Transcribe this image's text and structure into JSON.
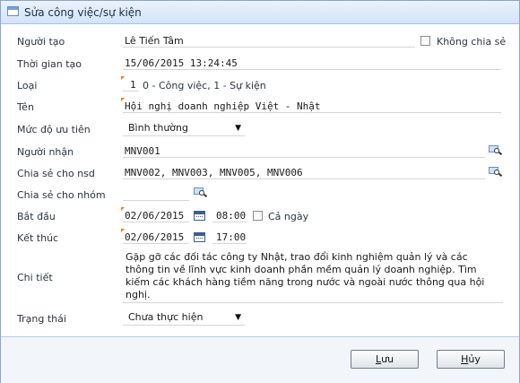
{
  "dialog": {
    "title": "Sửa công việc/sự kiện"
  },
  "form": {
    "creator": {
      "label": "Người tạo",
      "value": "Lê Tiến Tâm"
    },
    "no_share": {
      "label": "Không chia sẻ",
      "checked": false
    },
    "created_time": {
      "label": "Thời gian tạo",
      "value": "15/06/2015 13:24:45"
    },
    "type": {
      "label": "Loại",
      "value": "1",
      "hint": "0 - Công việc, 1 - Sự kiện"
    },
    "name": {
      "label": "Tên",
      "value": "Hội nghị doanh nghiệp Việt - Nhật"
    },
    "priority": {
      "label": "Mức độ ưu tiên",
      "value": "Bình thường"
    },
    "recipient": {
      "label": "Người nhận",
      "value": "MNV001"
    },
    "share_users": {
      "label": "Chia sẻ cho nsd",
      "value": "MNV002, MNV003, MNV005, MNV006"
    },
    "share_groups": {
      "label": "Chia sẻ cho nhóm",
      "value": ""
    },
    "start": {
      "label": "Bắt đầu",
      "date": "02/06/2015",
      "time": "08:00"
    },
    "all_day": {
      "label": "Cả ngày",
      "checked": false
    },
    "end": {
      "label": "Kết thúc",
      "date": "02/06/2015",
      "time": "17:00"
    },
    "detail": {
      "label": "Chi tiết",
      "lines": [
        "Gặp gỡ các đối tác công ty Nhật, trao đổi kinh nghiệm quản lý và các",
        "thông tin về lĩnh vực kinh doanh phần mềm quản lý doanh nghiệp. Tìm",
        "kiếm các khách hàng tiềm năng trong nước và ngoài nước thông qua hội",
        "nghị."
      ]
    },
    "status": {
      "label": "Trạng thái",
      "value": "Chưa thực hiện"
    }
  },
  "buttons": {
    "save": {
      "mnemonic": "L",
      "rest": "ưu"
    },
    "cancel": {
      "mnemonic": "H",
      "rest": "ủy"
    }
  },
  "icons": {
    "dropdown_arrow": "▼"
  }
}
